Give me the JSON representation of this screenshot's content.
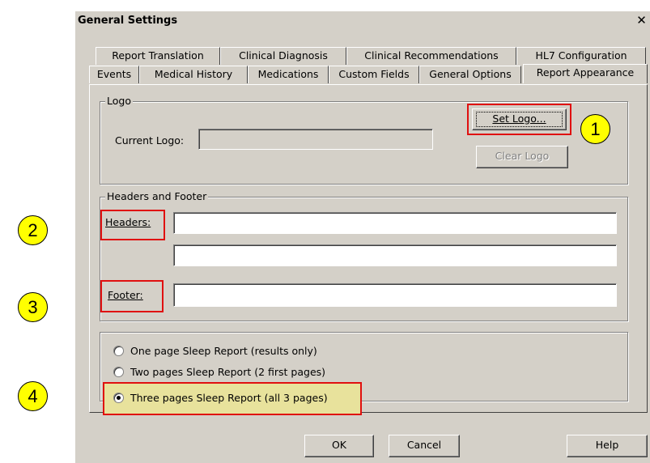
{
  "dialog": {
    "title": "General Settings",
    "close_glyph": "✕"
  },
  "tabs_row1": [
    "Report Translation",
    "Clinical Diagnosis",
    "Clinical Recommendations",
    "HL7 Configuration"
  ],
  "tabs_row2": [
    "Events",
    "Medical History",
    "Medications",
    "Custom Fields",
    "General Options",
    "Report Appearance"
  ],
  "active_tab": "Report Appearance",
  "logo": {
    "group_title": "Logo",
    "current_label": "Current Logo:",
    "current_value": "",
    "set_button": "Set Logo...",
    "clear_button": "Clear Logo"
  },
  "headers_footer": {
    "group_title": "Headers and Footer",
    "headers_label": "Headers:",
    "header1_value": "",
    "header2_value": "",
    "footer_label": "Footer:",
    "footer_value": ""
  },
  "report_options": [
    {
      "label": "One page Sleep Report (results only)",
      "checked": false
    },
    {
      "label": "Two pages Sleep Report (2 first pages)",
      "checked": false
    },
    {
      "label": "Three pages Sleep Report (all 3 pages)",
      "checked": true
    }
  ],
  "buttons": {
    "ok": "OK",
    "cancel": "Cancel",
    "help": "Help"
  },
  "callouts": [
    "1",
    "2",
    "3",
    "4"
  ],
  "colors": {
    "dialog_bg": "#d4d0c8",
    "callout": "#ffff00",
    "highlight_box": "#e01010"
  }
}
